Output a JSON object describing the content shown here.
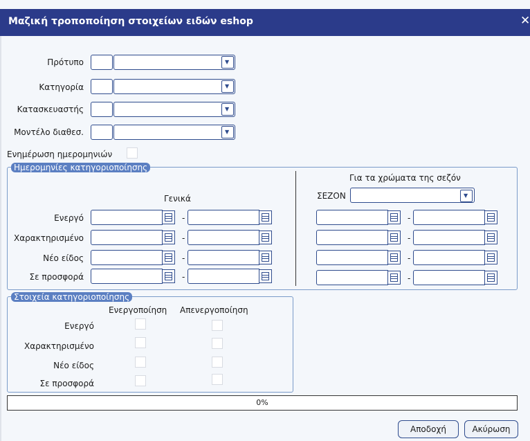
{
  "window": {
    "title": "Μαζική τροποποίηση στοιχείων ειδών eshop",
    "close_glyph": "✕"
  },
  "fields": {
    "protypo_label": "Πρότυπο",
    "kategoria_label": "Κατηγορία",
    "kataskevastis_label": "Κατασκευαστής",
    "montelo_label": "Μοντέλο διαθεσ."
  },
  "update_dates_label": "Ενημέρωση ημερομηνιών",
  "dates_group": {
    "legend": "Ημερομηνίες κατηγοριοποίησης",
    "general_header": "Γενικά",
    "season_header": "Για τα χρώματα της σεζόν",
    "season_label": "ΣΕΖΟΝ",
    "rows": [
      "Ενεργό",
      "Χαρακτηρισμένο",
      "Νέο είδος",
      "Σε προσφορά"
    ],
    "separator": "-"
  },
  "class_group": {
    "legend": "Στοιχεία κατηγοριοποίησης",
    "col_activate": "Ενεργοποίηση",
    "col_deactivate": "Απενεργοποίηση",
    "rows": [
      "Ενεργό",
      "Χαρακτηρισμένο",
      "Νέο είδος",
      "Σε προσφορά"
    ]
  },
  "progress": {
    "value": 0,
    "label": "0%"
  },
  "buttons": {
    "accept": "Αποδοχή",
    "cancel": "Ακύρωση"
  },
  "colors": {
    "titlebar": "#2b3b8a",
    "legend": "#5b7fc2",
    "border": "#2e4b8d"
  }
}
